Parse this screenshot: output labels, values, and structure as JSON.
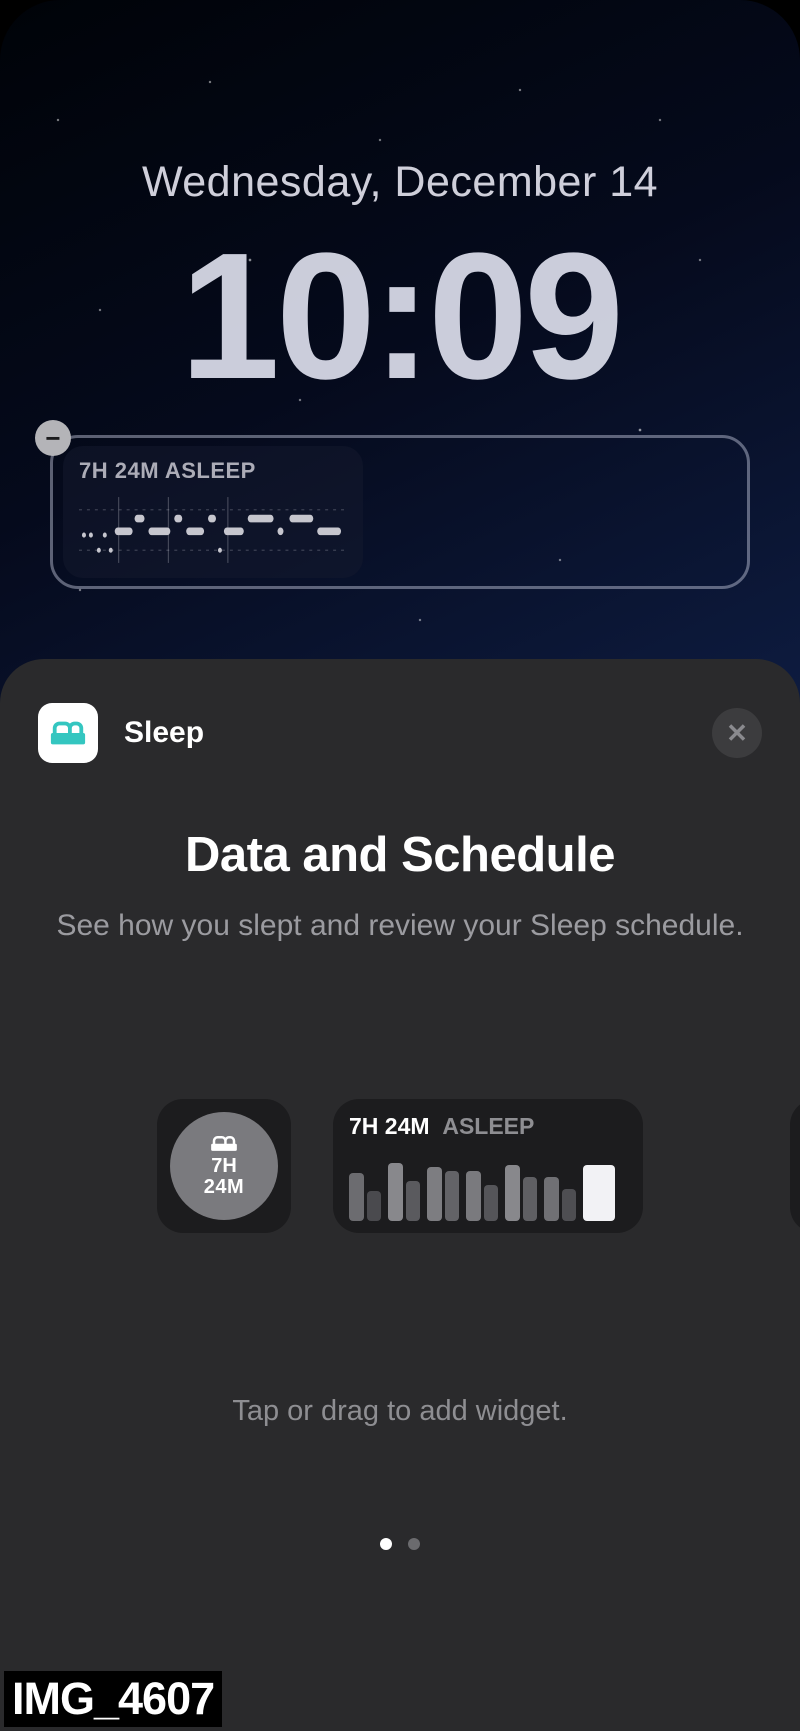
{
  "lock_screen": {
    "date": "Wednesday, December 14",
    "time": "10:09",
    "placed_widget": {
      "label": "7H 24M ASLEEP"
    }
  },
  "sheet": {
    "app_name": "Sleep",
    "title": "Data and Schedule",
    "subtitle": "See how you slept and review your Sleep schedule.",
    "widget_small": {
      "line1": "7H",
      "line2": "24M"
    },
    "widget_wide": {
      "duration": "7H 24M",
      "status": "ASLEEP"
    },
    "hint": "Tap or drag to add widget.",
    "pager": {
      "count": 2,
      "active": 0
    }
  },
  "filename": "IMG_4607"
}
